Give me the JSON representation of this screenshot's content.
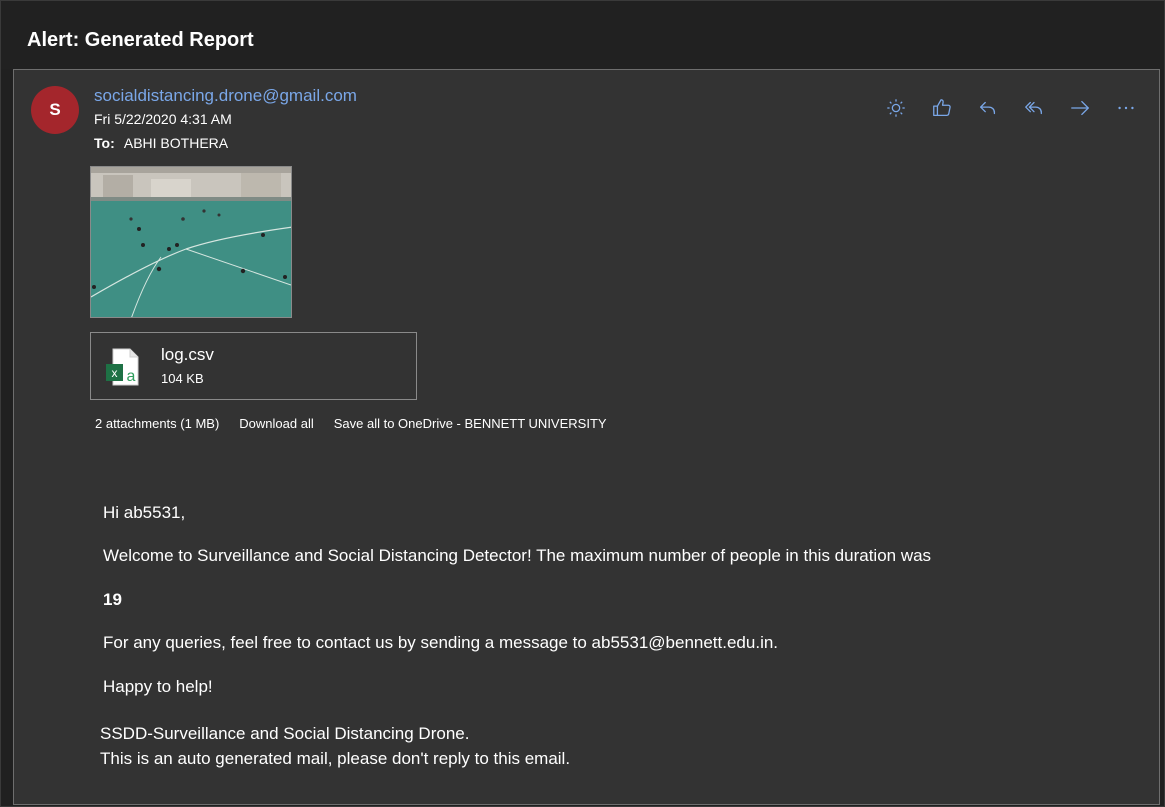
{
  "subject": "Alert: Generated Report",
  "sender": {
    "initial": "S",
    "email": "socialdistancing.drone@gmail.com",
    "avatar_color": "#a4262c"
  },
  "date": "Fri 5/22/2020 4:31 AM",
  "to": {
    "label": "To:",
    "name": "ABHI BOTHERA"
  },
  "actions": [
    {
      "name": "sun-icon"
    },
    {
      "name": "like-icon"
    },
    {
      "name": "reply-icon"
    },
    {
      "name": "reply-all-icon"
    },
    {
      "name": "forward-icon"
    },
    {
      "name": "more-icon"
    }
  ],
  "attachment_file": {
    "name": "log.csv",
    "size": "104 KB",
    "icon": "excel-icon"
  },
  "attachments_bar": {
    "count": "2 attachments (1 MB)",
    "download_all": "Download all",
    "save_all": "Save all to OneDrive - BENNETT UNIVERSITY"
  },
  "body": {
    "greeting": "Hi ab5531,",
    "line1": "Welcome to Surveillance and Social Distancing Detector! The maximum number of people in this duration was",
    "count": "19",
    "line2": "For any queries, feel free to contact us by sending a message to ab5531@bennett.edu.in.",
    "line3": "Happy to help!"
  },
  "signature": {
    "line1": "SSDD-Surveillance and Social Distancing Drone.",
    "line2": "This is an auto generated mail, please don't reply to this email."
  },
  "colors": {
    "accent": "#7aa7e8",
    "background": "#333333",
    "header": "#212121"
  }
}
